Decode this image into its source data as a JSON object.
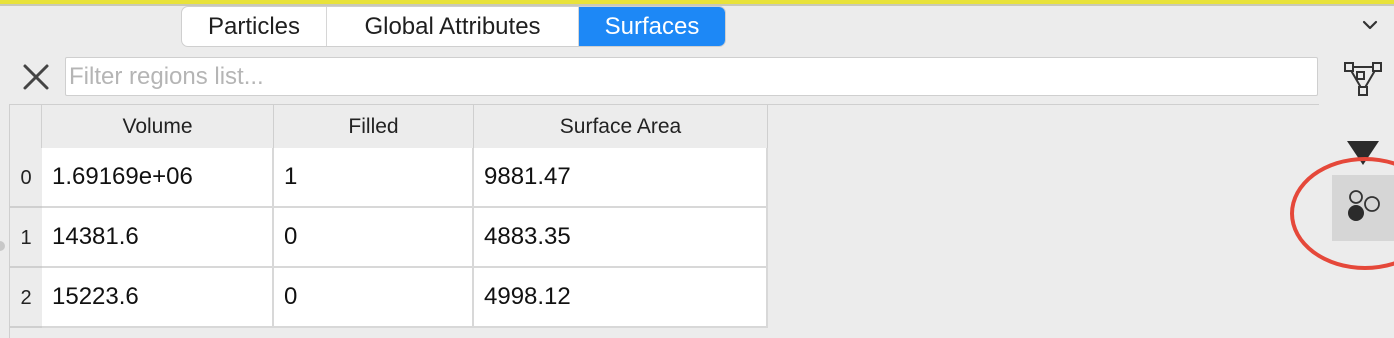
{
  "tabs": [
    {
      "label": "Particles",
      "active": false
    },
    {
      "label": "Global Attributes",
      "active": false
    },
    {
      "label": "Surfaces",
      "active": true
    }
  ],
  "filter": {
    "placeholder": "Filter regions list...",
    "value": ""
  },
  "table": {
    "columns": [
      "Volume",
      "Filled",
      "Surface Area"
    ],
    "rows": [
      {
        "index": "0",
        "cells": [
          "1.69169e+06",
          "1",
          "9881.47"
        ]
      },
      {
        "index": "1",
        "cells": [
          "14381.6",
          "0",
          "4883.35"
        ]
      },
      {
        "index": "2",
        "cells": [
          "15223.6",
          "0",
          "4998.12"
        ]
      }
    ]
  },
  "icons": {
    "collapse": "chevron-down-icon",
    "clear": "close-icon",
    "toolbar": [
      "vertex-graph-icon",
      "down-triangle-icon",
      "circles-icon"
    ]
  },
  "colors": {
    "active_tab": "#1d88f6",
    "highlight_circle": "#e5483a",
    "top_strip": "#e8e23a"
  }
}
